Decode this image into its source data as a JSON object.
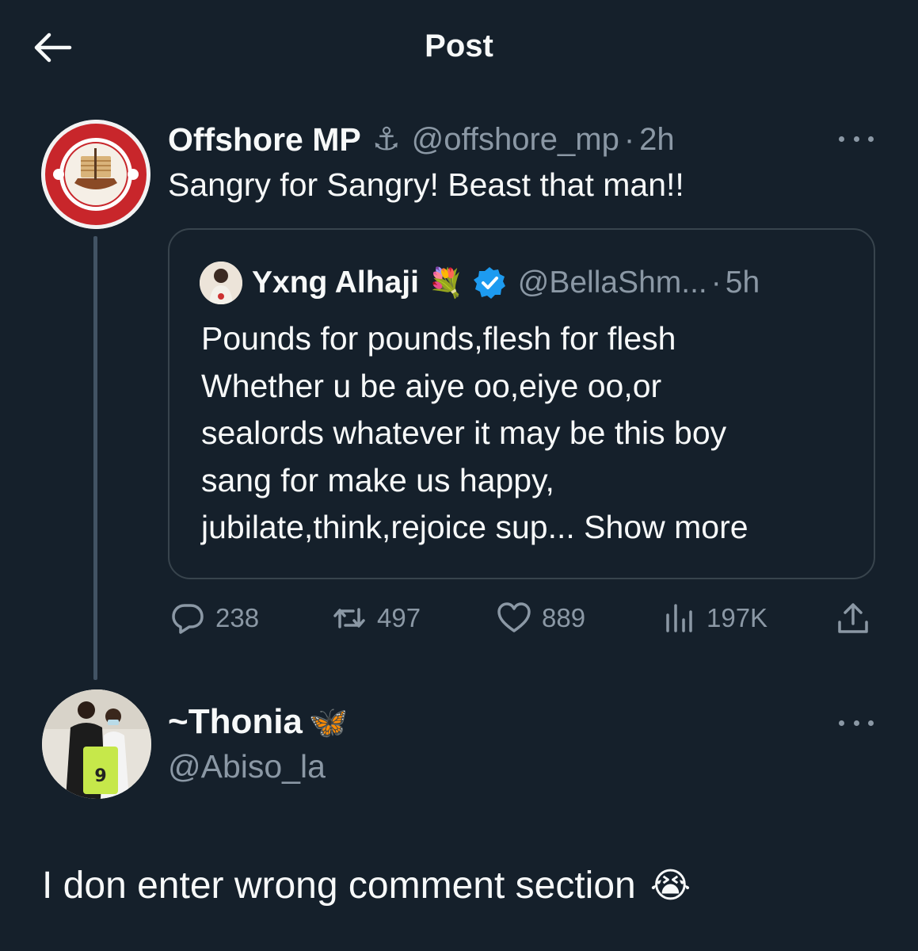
{
  "header": {
    "title": "Post",
    "back_icon": "arrow-left-icon"
  },
  "post": {
    "display_name": "Offshore MP",
    "name_emoji": "⚓",
    "handle": "@offshore_mp",
    "separator": "·",
    "time": "2h",
    "text": "Sangry for Sangry! Beast that man!!",
    "avatar_icon": "offshore-marine-patrol-logo",
    "quote": {
      "display_name": "Yxng Alhaji",
      "name_emoji": "💐",
      "verified": true,
      "handle": "@BellaShm...",
      "separator": "·",
      "time": "5h",
      "lines": [
        "Pounds for pounds,flesh for flesh",
        "Whether u be aiye oo,eiye oo,or",
        "sealords whatever it may be this boy",
        "sang for make us happy,",
        "jubilate,think,rejoice sup..."
      ],
      "show_more": "Show more"
    },
    "actions": {
      "replies": "238",
      "reposts": "497",
      "likes": "889",
      "views": "197K"
    }
  },
  "reply": {
    "display_name": "~Thonia",
    "name_emoji": "🦋",
    "handle": "@Abiso_la",
    "text": "I don enter wrong comment section",
    "text_emoji": "😭"
  },
  "colors": {
    "background": "#15202b",
    "primary_text": "#f7f9f9",
    "secondary_text": "#8b98a5",
    "border": "#38444d",
    "verified": "#1d9bf0"
  }
}
